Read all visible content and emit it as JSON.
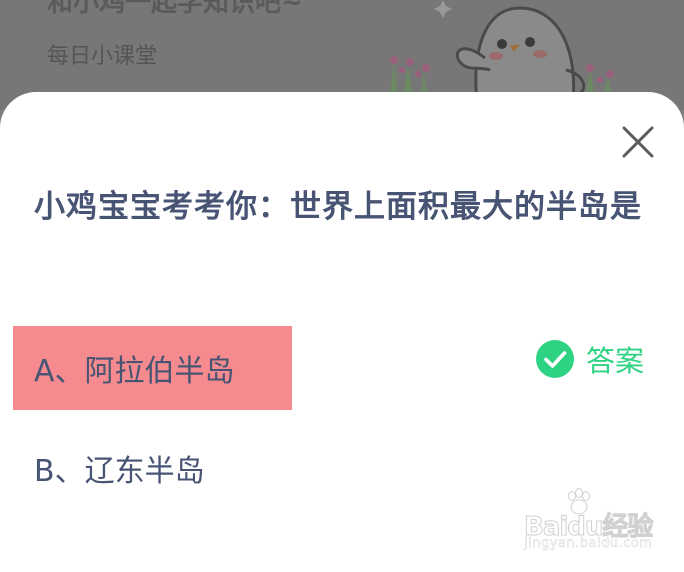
{
  "background": {
    "title": "和小鸡一起学知识吧~",
    "subtitle": "每日小课堂",
    "mascot_icon": "chick-mascot-icon"
  },
  "dialog": {
    "close_icon": "close-icon",
    "question": "小鸡宝宝考考你：世界上面积最大的半岛是",
    "options": [
      {
        "label": "A、阿拉伯半岛",
        "highlight_color": "#f58b8f"
      },
      {
        "label": "B、辽东半岛"
      }
    ],
    "answer_label": "答案",
    "answer_icon": "checkmark-circle-icon",
    "answer_color": "#2ed283"
  },
  "watermark": {
    "logo_text": "Bai",
    "logo_suffix": "du",
    "logo_cn": "经验",
    "site": "jingyan.baidu.com"
  }
}
